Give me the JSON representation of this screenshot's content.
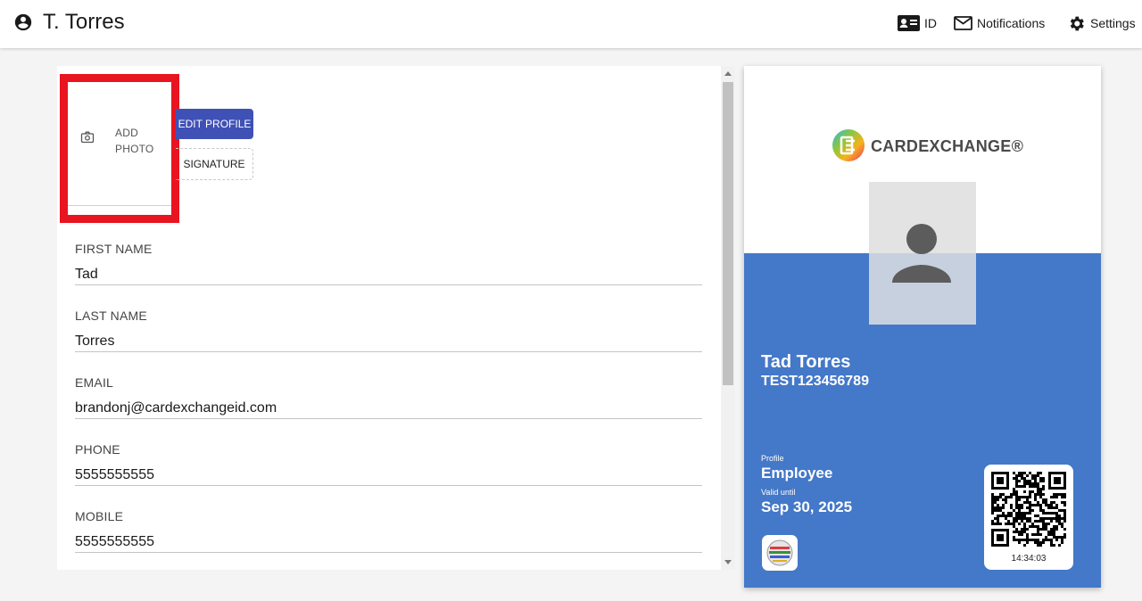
{
  "header": {
    "user_name": "T. Torres",
    "nav": {
      "id_label": "ID",
      "notifications_label": "Notifications",
      "settings_label": "Settings"
    }
  },
  "photo": {
    "add_photo_line1": "ADD",
    "add_photo_line2": "PHOTO"
  },
  "buttons": {
    "edit_profile": "EDIT PROFILE",
    "signature": "SIGNATURE"
  },
  "fields": [
    {
      "label": "FIRST NAME",
      "value": "Tad"
    },
    {
      "label": "LAST NAME",
      "value": "Torres"
    },
    {
      "label": "EMAIL",
      "value": "brandonj@cardexchangeid.com"
    },
    {
      "label": "PHONE",
      "value": "5555555555"
    },
    {
      "label": "MOBILE",
      "value": "5555555555"
    }
  ],
  "card": {
    "brand": "CARDEXCHANGE®",
    "name": "Tad Torres",
    "id_number": "TEST123456789",
    "profile_label": "Profile",
    "profile_value": "Employee",
    "valid_label": "Valid until",
    "valid_value": "Sep 30, 2025",
    "qr_time": "14:34:03",
    "colors": {
      "card_blue": "#4478c8",
      "button_blue": "#3f51b5",
      "highlight_red": "#e8141f"
    }
  }
}
